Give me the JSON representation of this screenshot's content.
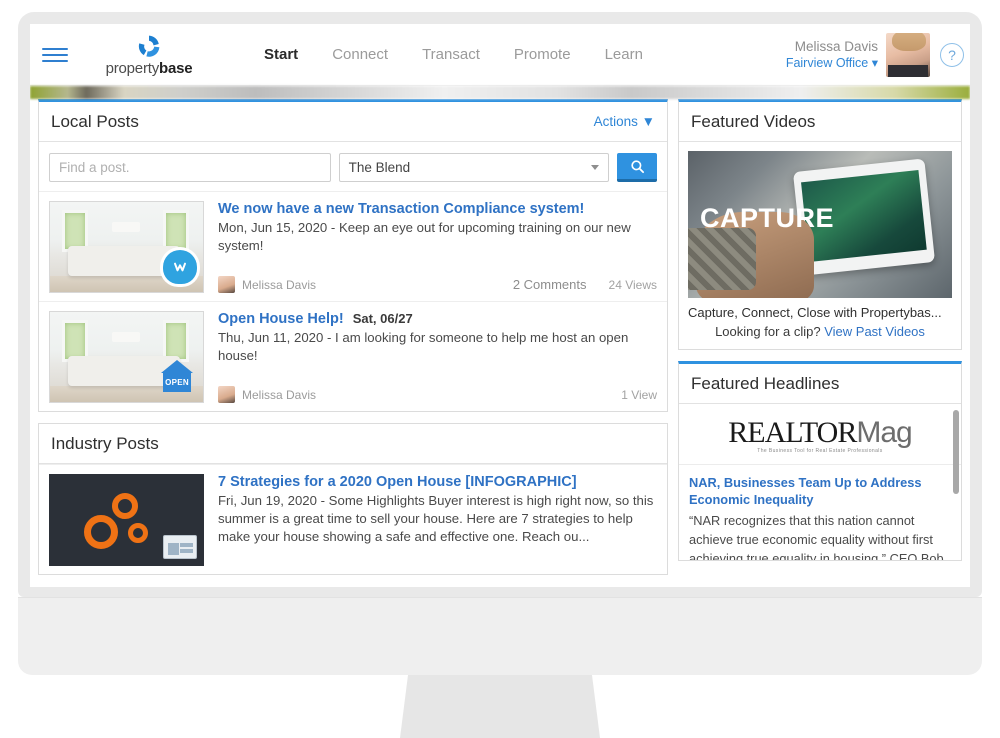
{
  "header": {
    "brand_primary": "property",
    "brand_bold": "base",
    "nav": [
      {
        "label": "Start",
        "active": true
      },
      {
        "label": "Connect",
        "active": false
      },
      {
        "label": "Transact",
        "active": false
      },
      {
        "label": "Promote",
        "active": false
      },
      {
        "label": "Learn",
        "active": false
      }
    ],
    "user_name": "Melissa Davis",
    "user_office": "Fairview Office ▾",
    "help_glyph": "?"
  },
  "local_posts": {
    "title": "Local Posts",
    "actions_label": "Actions ▼",
    "search_placeholder": "Find a post.",
    "search_value": "",
    "filter_value": "The Blend",
    "posts": [
      {
        "title": "We now have a new Transaction Compliance system!",
        "date_tag": "",
        "snippet": "Mon, Jun 15, 2020 - Keep an eye out for upcoming training on our new system!",
        "author": "Melissa Davis",
        "comments": "2 Comments",
        "views": "24 Views",
        "badge": "lightbulb-badge"
      },
      {
        "title": "Open House Help!",
        "date_tag": "Sat, 06/27",
        "snippet": "Thu, Jun 11, 2020 - I am looking for someone to help me host an open house!",
        "author": "Melissa Davis",
        "comments": "",
        "views": "1 View",
        "badge": "open-house-badge"
      }
    ]
  },
  "industry_posts": {
    "title": "Industry Posts",
    "posts": [
      {
        "title": "7 Strategies for a 2020 Open House [INFOGRAPHIC]",
        "snippet": "Fri, Jun 19, 2020 - Some Highlights Buyer interest is high right now, so this summer is a great time to sell your house. Here are 7 strategies to help make your house showing a safe and effective one. Reach ou...",
        "badge": "news-badge"
      }
    ]
  },
  "featured_videos": {
    "title": "Featured Videos",
    "overlay_word": "CAPTURE",
    "caption": "Capture, Connect, Close with Propertybas...",
    "prompt": "Looking for a clip?",
    "link_label": "View Past Videos"
  },
  "featured_headlines": {
    "title": "Featured Headlines",
    "logo_main": "REALTOR",
    "logo_suffix": "Mag",
    "logo_tagline": "The Business Tool for Real Estate Professionals",
    "items": [
      {
        "headline": "NAR, Businesses Team Up to Address Economic Inequality",
        "summary": "“NAR recognizes that this nation cannot achieve true economic equality without first achieving true equality in housing,” CEO Bob Goldberg says."
      }
    ]
  },
  "colors": {
    "accent_blue": "#2f92e0",
    "link_blue": "#2f72c4",
    "panel_border": "#dcdcdc",
    "orange": "#ef7215"
  }
}
